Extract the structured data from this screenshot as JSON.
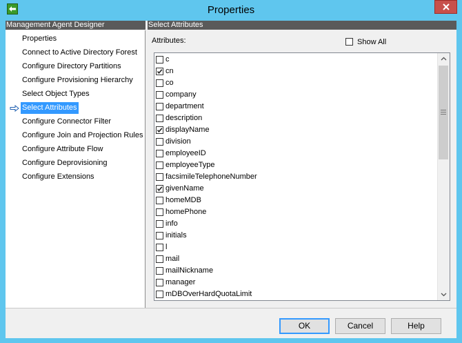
{
  "window": {
    "title": "Properties",
    "accent_color": "#5fc6ee",
    "close_color": "#c7504b"
  },
  "left_pane": {
    "header": "Management Agent Designer",
    "items": [
      {
        "label": "Properties",
        "selected": false
      },
      {
        "label": "Connect to Active Directory Forest",
        "selected": false
      },
      {
        "label": "Configure Directory Partitions",
        "selected": false
      },
      {
        "label": "Configure Provisioning Hierarchy",
        "selected": false
      },
      {
        "label": "Select Object Types",
        "selected": false
      },
      {
        "label": "Select Attributes",
        "selected": true
      },
      {
        "label": "Configure Connector Filter",
        "selected": false
      },
      {
        "label": "Configure Join and Projection Rules",
        "selected": false
      },
      {
        "label": "Configure Attribute Flow",
        "selected": false
      },
      {
        "label": "Configure Deprovisioning",
        "selected": false
      },
      {
        "label": "Configure Extensions",
        "selected": false
      }
    ]
  },
  "right_pane": {
    "header": "Select Attributes",
    "attributes_label": "Attributes:",
    "show_all_label": "Show All",
    "show_all_checked": false,
    "attributes": [
      {
        "name": "c",
        "checked": false
      },
      {
        "name": "cn",
        "checked": true
      },
      {
        "name": "co",
        "checked": false
      },
      {
        "name": "company",
        "checked": false
      },
      {
        "name": "department",
        "checked": false
      },
      {
        "name": "description",
        "checked": false
      },
      {
        "name": "displayName",
        "checked": true
      },
      {
        "name": "division",
        "checked": false
      },
      {
        "name": "employeeID",
        "checked": false
      },
      {
        "name": "employeeType",
        "checked": false
      },
      {
        "name": "facsimileTelephoneNumber",
        "checked": false
      },
      {
        "name": "givenName",
        "checked": true
      },
      {
        "name": "homeMDB",
        "checked": false
      },
      {
        "name": "homePhone",
        "checked": false
      },
      {
        "name": "info",
        "checked": false
      },
      {
        "name": "initials",
        "checked": false
      },
      {
        "name": "l",
        "checked": false
      },
      {
        "name": "mail",
        "checked": false
      },
      {
        "name": "mailNickname",
        "checked": false
      },
      {
        "name": "manager",
        "checked": false
      },
      {
        "name": "mDBOverHardQuotaLimit",
        "checked": false
      }
    ]
  },
  "buttons": {
    "ok": "OK",
    "cancel": "Cancel",
    "help": "Help"
  }
}
